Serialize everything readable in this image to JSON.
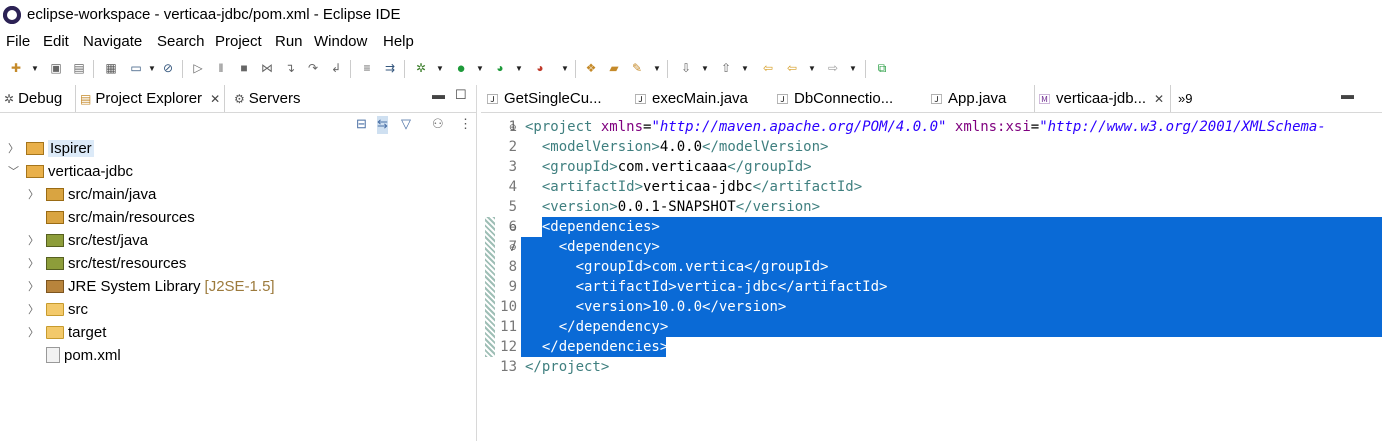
{
  "window": {
    "title": "eclipse-workspace - verticaa-jdbc/pom.xml - Eclipse IDE"
  },
  "menu": [
    "File",
    "Edit",
    "Navigate",
    "Search",
    "Project",
    "Run",
    "Window",
    "Help"
  ],
  "left_panel": {
    "tabs": [
      {
        "label": "Debug",
        "icon": "debug-icon"
      },
      {
        "label": "Project Explorer",
        "icon": "project-explorer-icon",
        "active": true
      },
      {
        "label": "Servers",
        "icon": "servers-icon"
      }
    ],
    "tree": [
      {
        "label": "Ispirer",
        "level": 0,
        "expanded": false,
        "icon": "project-icon",
        "selected": true
      },
      {
        "label": "verticaa-jdbc",
        "level": 0,
        "expanded": true,
        "icon": "maven-project-icon"
      },
      {
        "label": "src/main/java",
        "level": 1,
        "expanded": false,
        "icon": "package-folder-icon"
      },
      {
        "label": "src/main/resources",
        "level": 1,
        "expanded": null,
        "icon": "package-folder-icon"
      },
      {
        "label": "src/test/java",
        "level": 1,
        "expanded": false,
        "icon": "test-package-folder-icon"
      },
      {
        "label": "src/test/resources",
        "level": 1,
        "expanded": false,
        "icon": "test-package-folder-icon"
      },
      {
        "label": "JRE System Library",
        "decoration": "[J2SE-1.5]",
        "level": 1,
        "expanded": false,
        "icon": "library-icon"
      },
      {
        "label": "src",
        "level": 1,
        "expanded": false,
        "icon": "folder-icon"
      },
      {
        "label": "target",
        "level": 1,
        "expanded": false,
        "icon": "folder-icon"
      },
      {
        "label": "pom.xml",
        "level": 1,
        "expanded": null,
        "icon": "maven-file-icon"
      }
    ]
  },
  "editor": {
    "tabs": [
      {
        "label": "GetSingleCu...",
        "icon": "java-file-icon"
      },
      {
        "label": "execMain.java",
        "icon": "java-file-icon"
      },
      {
        "label": "DbConnectio...",
        "icon": "java-file-icon"
      },
      {
        "label": "App.java",
        "icon": "java-file-icon"
      },
      {
        "label": "verticaa-jdb...",
        "icon": "maven-file-icon",
        "active": true
      }
    ],
    "overflow_label": "»9",
    "lines": [
      {
        "n": "1",
        "fold": true,
        "parts": [
          [
            "tag",
            "<project "
          ],
          [
            "attr",
            "xmlns"
          ],
          [
            "txt",
            "="
          ],
          [
            "str",
            "\"http://maven.apache.org/POM/4.0.0\""
          ],
          [
            "txt",
            " "
          ],
          [
            "attr",
            "xmlns:xsi"
          ],
          [
            "txt",
            "="
          ],
          [
            "str",
            "\"http://www.w3.org/2001/XMLSchema-"
          ]
        ]
      },
      {
        "n": "2",
        "parts": [
          [
            "txt",
            "  "
          ],
          [
            "tag",
            "<modelVersion>"
          ],
          [
            "txt",
            "4.0.0"
          ],
          [
            "tag",
            "</modelVersion>"
          ]
        ]
      },
      {
        "n": "3",
        "parts": [
          [
            "txt",
            "  "
          ],
          [
            "tag",
            "<groupId>"
          ],
          [
            "txt",
            "com.verticaaa"
          ],
          [
            "tag",
            "</groupId>"
          ]
        ]
      },
      {
        "n": "4",
        "parts": [
          [
            "txt",
            "  "
          ],
          [
            "tag",
            "<artifactId>"
          ],
          [
            "txt",
            "verticaa-jdbc"
          ],
          [
            "tag",
            "</artifactId>"
          ]
        ]
      },
      {
        "n": "5",
        "parts": [
          [
            "txt",
            "  "
          ],
          [
            "tag",
            "<version>"
          ],
          [
            "txt",
            "0.0.1-SNAPSHOT"
          ],
          [
            "tag",
            "</version>"
          ]
        ]
      },
      {
        "n": "6",
        "fold": true,
        "selected": true,
        "parts": [
          [
            "txt",
            "  "
          ],
          [
            "tag",
            "<dependencies>"
          ]
        ]
      },
      {
        "n": "7",
        "fold": true,
        "selected": true,
        "parts": [
          [
            "txt",
            "    "
          ],
          [
            "tag",
            "<dependency>"
          ]
        ]
      },
      {
        "n": "8",
        "selected": true,
        "parts": [
          [
            "txt",
            "      "
          ],
          [
            "tag",
            "<groupId>"
          ],
          [
            "txt",
            "com.vertica"
          ],
          [
            "tag",
            "</groupId>"
          ]
        ]
      },
      {
        "n": "9",
        "selected": true,
        "parts": [
          [
            "txt",
            "      "
          ],
          [
            "tag",
            "<artifactId>"
          ],
          [
            "txt",
            "vertica-jdbc"
          ],
          [
            "tag",
            "</artifactId>"
          ]
        ]
      },
      {
        "n": "10",
        "selected": true,
        "parts": [
          [
            "txt",
            "      "
          ],
          [
            "tag",
            "<version>"
          ],
          [
            "txt",
            "10.0.0"
          ],
          [
            "tag",
            "</version>"
          ]
        ]
      },
      {
        "n": "11",
        "selected": true,
        "parts": [
          [
            "txt",
            "    "
          ],
          [
            "tag",
            "</dependency>"
          ]
        ]
      },
      {
        "n": "12",
        "selected": true,
        "partial": true,
        "parts": [
          [
            "txt",
            "  "
          ],
          [
            "tag",
            "</dependencies>"
          ]
        ]
      },
      {
        "n": "13",
        "parts": [
          [
            "tag",
            "</project>"
          ]
        ]
      }
    ]
  },
  "colors": {
    "selection": "#0a6ad6",
    "tag": "#3f7f7f",
    "attribute": "#7f007f",
    "string": "#2a00ff"
  }
}
